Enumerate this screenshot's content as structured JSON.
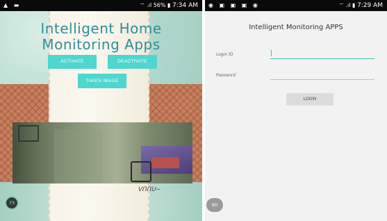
{
  "left_screen": {
    "status_bar": {
      "clock": "7:34 AM",
      "battery": "56%"
    },
    "title_line1": "Intelligent Home",
    "title_line2": "Monitoring Apps",
    "buttons": {
      "activate": "ACTIVATE",
      "deactivate": "DEACTIVATE",
      "taken_image": "TAKEN IMAGE"
    },
    "badge": "73",
    "signature": "ᐯᑎᑎᑌ~"
  },
  "right_screen": {
    "status_bar": {
      "clock": "7:29 AM"
    },
    "title": "Intelligent Monitoring APPS",
    "login_label": "Login ID",
    "password_label": "Password",
    "login_value": "",
    "password_value": "",
    "login_button": "LOGIN",
    "badge": "80"
  },
  "colors": {
    "accent_cyan": "#4fd6cf",
    "title_teal": "#2f8e9a",
    "field_focus": "#3cbfae"
  }
}
